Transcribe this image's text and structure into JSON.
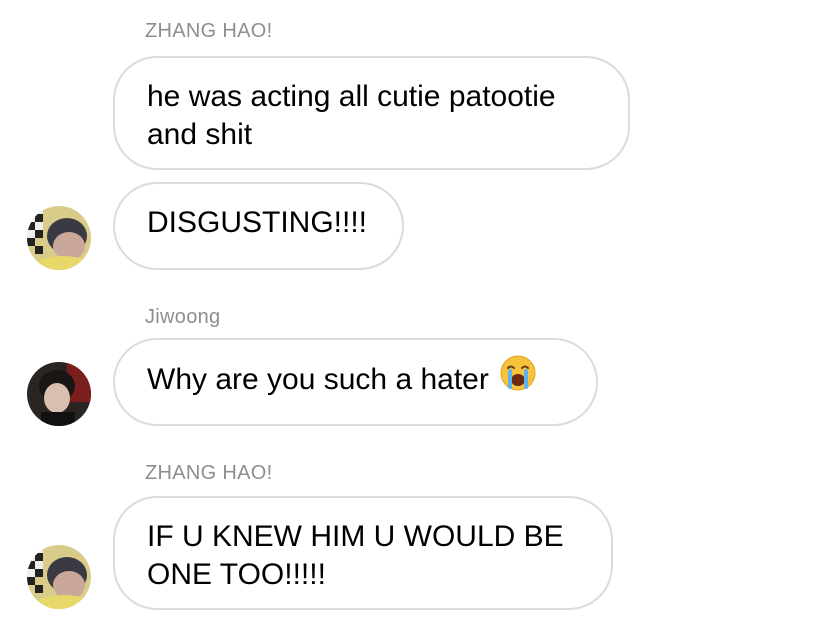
{
  "messages": [
    {
      "sender": "ZHANG HAO!",
      "text_lines": [
        "he was acting all cutie patootie",
        "and shit"
      ]
    },
    {
      "text": "DISGUSTING!!!!"
    },
    {
      "sender": "Jiwoong",
      "text": "Why are you such a hater",
      "emoji": "loudly-crying-face-emoji"
    },
    {
      "sender": "ZHANG HAO!",
      "text_lines": [
        "IF U KNEW HIM U WOULD BE",
        "ONE TOO!!!!!"
      ]
    }
  ],
  "avatars": {
    "zhang_hao": "avatar-zhang-hao",
    "jiwoong": "avatar-jiwoong"
  },
  "colors": {
    "sender_name": "#8e8e8e",
    "bubble_border": "#dbdbdb",
    "text": "#000000",
    "background": "#ffffff"
  }
}
